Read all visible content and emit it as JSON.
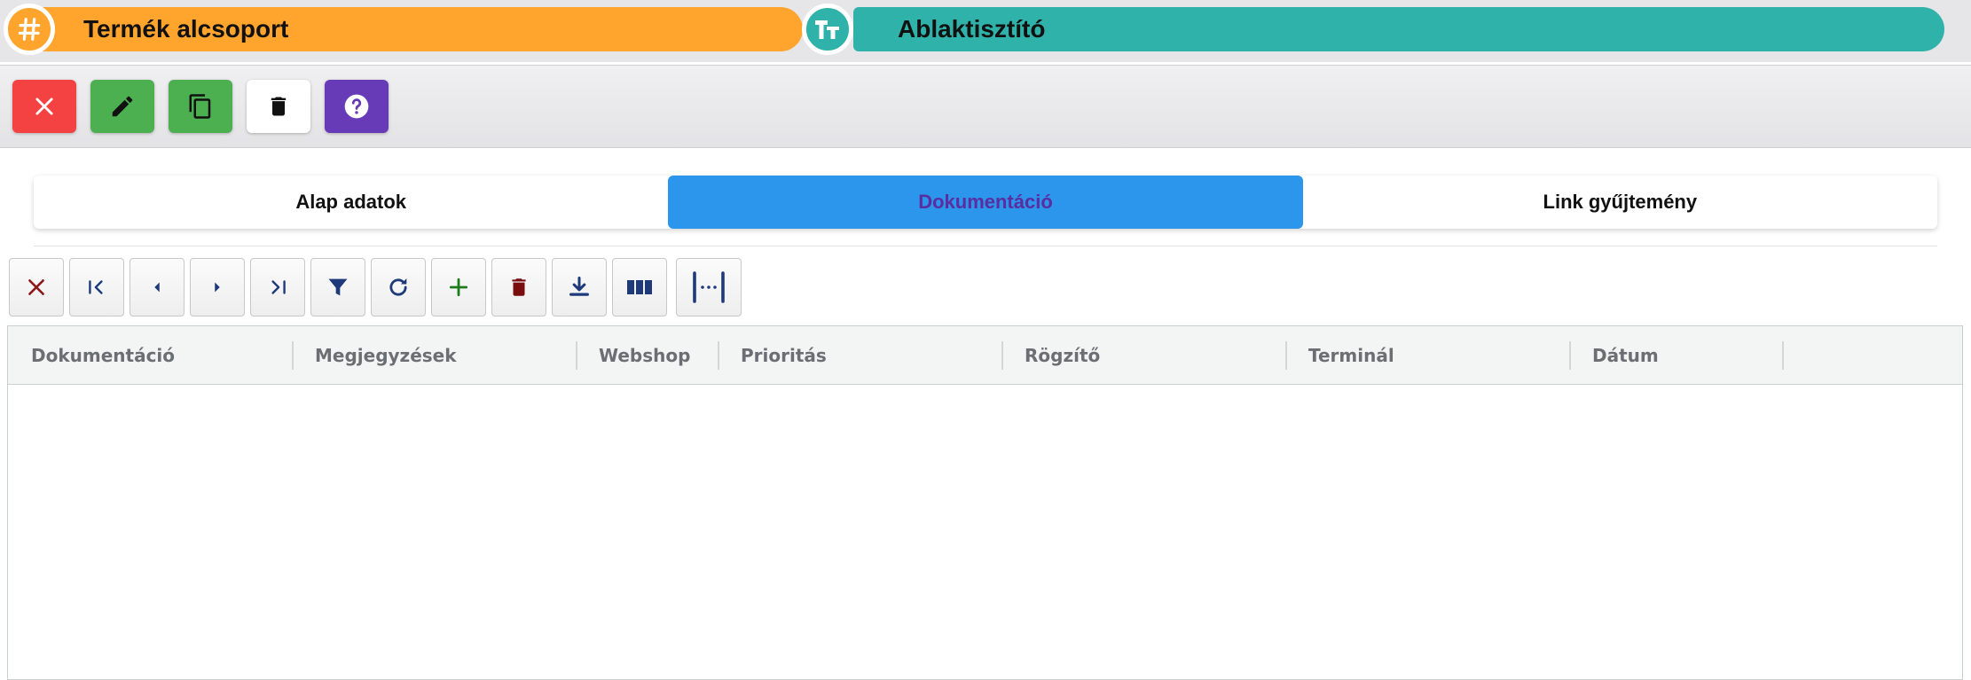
{
  "header": {
    "left_title": "Termék alcsoport",
    "right_title": "Ablaktisztító",
    "left_icon": "hash-icon",
    "right_icon": "text-type-icon",
    "left_color": "#ffa42c",
    "right_color": "#2fb2a9"
  },
  "toolbar": {
    "buttons": [
      {
        "name": "close",
        "icon": "close-icon",
        "color": "#f44242"
      },
      {
        "name": "edit",
        "icon": "pencil-icon",
        "color": "#4caf50"
      },
      {
        "name": "copy",
        "icon": "copy-icon",
        "color": "#4caf50"
      },
      {
        "name": "delete",
        "icon": "trash-icon",
        "color": "#ffffff"
      },
      {
        "name": "help",
        "icon": "help-icon",
        "color": "#673ab7"
      }
    ]
  },
  "tabs": {
    "items": [
      {
        "label": "Alap adatok",
        "active": false
      },
      {
        "label": "Dokumentáció",
        "active": true
      },
      {
        "label": "Link gyűjtemény",
        "active": false
      }
    ],
    "active_color": "#2b96ec"
  },
  "grid_toolbar": {
    "buttons": [
      {
        "name": "close",
        "icon": "close-icon"
      },
      {
        "name": "first",
        "icon": "first-page-icon"
      },
      {
        "name": "prev",
        "icon": "prev-icon"
      },
      {
        "name": "next",
        "icon": "next-icon"
      },
      {
        "name": "last",
        "icon": "last-page-icon"
      },
      {
        "name": "filter",
        "icon": "filter-icon"
      },
      {
        "name": "refresh",
        "icon": "refresh-icon"
      },
      {
        "name": "add",
        "icon": "plus-icon"
      },
      {
        "name": "delete",
        "icon": "trash-icon"
      },
      {
        "name": "download",
        "icon": "download-icon"
      },
      {
        "name": "columns",
        "icon": "columns-icon"
      },
      {
        "name": "fit-width",
        "icon": "fit-width-icon"
      }
    ]
  },
  "table": {
    "columns": [
      "Dokumentáció",
      "Megjegyzések",
      "Webshop",
      "Prioritás",
      "Rögzítő",
      "Terminál",
      "Dátum"
    ],
    "rows": []
  }
}
